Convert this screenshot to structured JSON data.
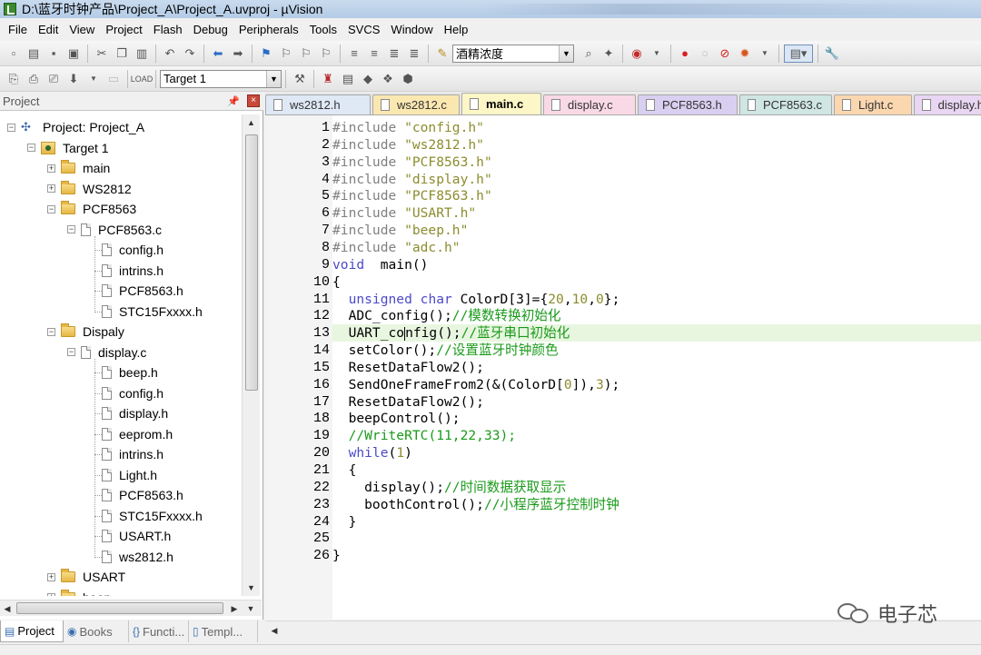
{
  "window": {
    "title": "D:\\蓝牙时钟产品\\Project_A\\Project_A.uvproj - µVision"
  },
  "menu": [
    "File",
    "Edit",
    "View",
    "Project",
    "Flash",
    "Debug",
    "Peripherals",
    "Tools",
    "SVCS",
    "Window",
    "Help"
  ],
  "toolbar": {
    "find_combo_value": "酒精浓度",
    "target_combo_value": "Target 1"
  },
  "project_panel": {
    "title": "Project",
    "tree": [
      {
        "label": "Project: Project_A"
      },
      {
        "label": "Target 1"
      },
      {
        "label": "main"
      },
      {
        "label": "WS2812"
      },
      {
        "label": "PCF8563"
      },
      {
        "label": "PCF8563.c"
      },
      {
        "label": "config.h"
      },
      {
        "label": "intrins.h"
      },
      {
        "label": "PCF8563.h"
      },
      {
        "label": "STC15Fxxxx.h"
      },
      {
        "label": "Dispaly"
      },
      {
        "label": "display.c"
      },
      {
        "label": "beep.h"
      },
      {
        "label": "config.h"
      },
      {
        "label": "display.h"
      },
      {
        "label": "eeprom.h"
      },
      {
        "label": "intrins.h"
      },
      {
        "label": "Light.h"
      },
      {
        "label": "PCF8563.h"
      },
      {
        "label": "STC15Fxxxx.h"
      },
      {
        "label": "USART.h"
      },
      {
        "label": "ws2812.h"
      },
      {
        "label": "USART"
      },
      {
        "label": "beep"
      }
    ],
    "bottom_tabs": [
      {
        "label": "Project",
        "icon": "project-tab-icon"
      },
      {
        "label": "Books",
        "icon": "books-tab-icon"
      },
      {
        "label": "Functi...",
        "icon": "functions-tab-icon"
      },
      {
        "label": "Templ...",
        "icon": "templates-tab-icon"
      }
    ]
  },
  "editor": {
    "tabs": [
      {
        "label": "ws2812.h",
        "color": "#dfe8f5"
      },
      {
        "label": "ws2812.c",
        "color": "#fbe7b0"
      },
      {
        "label": "main.c",
        "color": "#fdf6c6"
      },
      {
        "label": "display.c",
        "color": "#f9d9e6"
      },
      {
        "label": "PCF8563.h",
        "color": "#d9cff0"
      },
      {
        "label": "PCF8563.c",
        "color": "#cfe6e2"
      },
      {
        "label": "Light.c",
        "color": "#fbd7b0"
      },
      {
        "label": "display.h",
        "color": "#e8d6f2"
      }
    ],
    "active_tab": "main.c",
    "current_line": 13,
    "lines": [
      {
        "n": "1",
        "t": [
          [
            "pp",
            "#include "
          ],
          [
            "str",
            "\"config.h\""
          ]
        ]
      },
      {
        "n": "2",
        "t": [
          [
            "pp",
            "#include "
          ],
          [
            "str",
            "\"ws2812.h\""
          ]
        ]
      },
      {
        "n": "3",
        "t": [
          [
            "pp",
            "#include "
          ],
          [
            "str",
            "\"PCF8563.h\""
          ]
        ]
      },
      {
        "n": "4",
        "t": [
          [
            "pp",
            "#include "
          ],
          [
            "str",
            "\"display.h\""
          ]
        ]
      },
      {
        "n": "5",
        "t": [
          [
            "pp",
            "#include "
          ],
          [
            "str",
            "\"PCF8563.h\""
          ]
        ]
      },
      {
        "n": "6",
        "t": [
          [
            "pp",
            "#include "
          ],
          [
            "str",
            "\"USART.h\""
          ]
        ]
      },
      {
        "n": "7",
        "t": [
          [
            "pp",
            "#include "
          ],
          [
            "str",
            "\"beep.h\""
          ]
        ]
      },
      {
        "n": "8",
        "t": [
          [
            "pp",
            "#include "
          ],
          [
            "str",
            "\"adc.h\""
          ]
        ]
      },
      {
        "n": "9",
        "t": [
          [
            "kw",
            "void"
          ],
          [
            "",
            "  main()"
          ]
        ]
      },
      {
        "n": "10",
        "t": [
          [
            "",
            "{"
          ]
        ]
      },
      {
        "n": "11",
        "t": [
          [
            "",
            "  "
          ],
          [
            "kw",
            "unsigned char"
          ],
          [
            "",
            " ColorD[3]={"
          ],
          [
            "num",
            "20"
          ],
          [
            "",
            ","
          ],
          [
            "num",
            "10"
          ],
          [
            "",
            ","
          ],
          [
            "num",
            "0"
          ],
          [
            "",
            "};"
          ]
        ]
      },
      {
        "n": "12",
        "t": [
          [
            "",
            "  ADC_config();"
          ],
          [
            "cm",
            "//模数转换初始化"
          ]
        ]
      },
      {
        "n": "13",
        "t": [
          [
            "",
            "  UART_co"
          ],
          [
            "cursor",
            ""
          ],
          [
            "",
            "nfig();"
          ],
          [
            "cm",
            "//蓝牙串口初始化"
          ]
        ]
      },
      {
        "n": "14",
        "t": [
          [
            "",
            "  setColor();"
          ],
          [
            "cm",
            "//设置蓝牙时钟颜色"
          ]
        ]
      },
      {
        "n": "15",
        "t": [
          [
            "",
            "  ResetDataFlow2();"
          ]
        ]
      },
      {
        "n": "16",
        "t": [
          [
            "",
            "  SendOneFrameFrom2(&(ColorD["
          ],
          [
            "num",
            "0"
          ],
          [
            "",
            "]),"
          ],
          [
            "num",
            "3"
          ],
          [
            "",
            ");"
          ]
        ]
      },
      {
        "n": "17",
        "t": [
          [
            "",
            "  ResetDataFlow2();"
          ]
        ]
      },
      {
        "n": "18",
        "t": [
          [
            "",
            "  beepControl();"
          ]
        ]
      },
      {
        "n": "19",
        "t": [
          [
            "",
            "  "
          ],
          [
            "cm",
            "//WriteRTC(11,22,33);"
          ]
        ]
      },
      {
        "n": "20",
        "t": [
          [
            "",
            "  "
          ],
          [
            "kw",
            "while"
          ],
          [
            "",
            "("
          ],
          [
            "num",
            "1"
          ],
          [
            "",
            ")"
          ]
        ]
      },
      {
        "n": "21",
        "t": [
          [
            "",
            "  {"
          ]
        ]
      },
      {
        "n": "22",
        "t": [
          [
            "",
            "    display();"
          ],
          [
            "cm",
            "//时间数据获取显示"
          ]
        ]
      },
      {
        "n": "23",
        "t": [
          [
            "",
            "    boothControl();"
          ],
          [
            "cm",
            "//小程序蓝牙控制时钟"
          ]
        ]
      },
      {
        "n": "24",
        "t": [
          [
            "",
            "  }"
          ]
        ]
      },
      {
        "n": "25",
        "t": [
          [
            "",
            ""
          ]
        ]
      },
      {
        "n": "26",
        "t": [
          [
            "",
            "}"
          ]
        ]
      }
    ]
  },
  "watermark": {
    "text": "电子芯"
  }
}
